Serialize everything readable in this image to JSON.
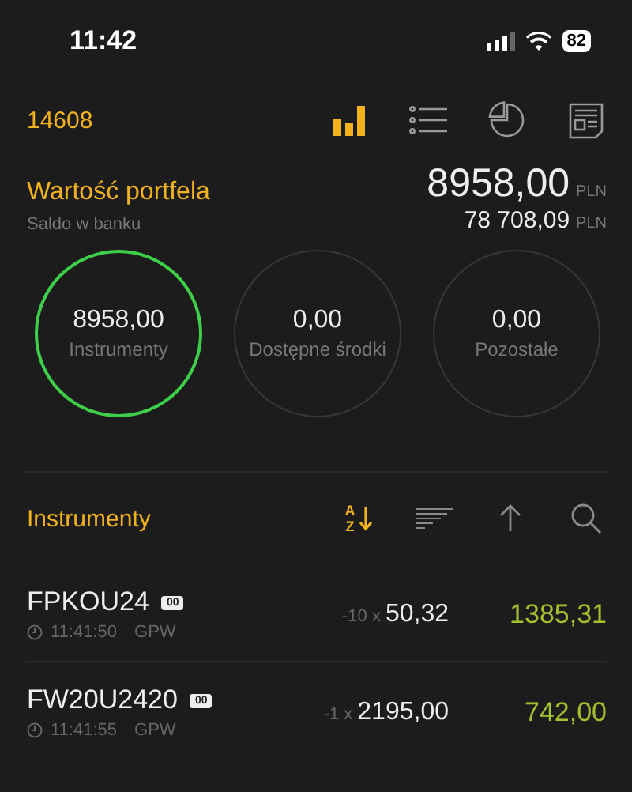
{
  "status_bar": {
    "time": "11:42",
    "battery": "82"
  },
  "header": {
    "account": "14608",
    "tabs": [
      {
        "kind": "bars",
        "selected": true
      },
      {
        "kind": "list",
        "selected": false
      },
      {
        "kind": "pie",
        "selected": false
      },
      {
        "kind": "news",
        "selected": false
      }
    ]
  },
  "portfolio": {
    "title": "Wartość portfela",
    "value": "8958,00",
    "currency": "PLN",
    "bank_label": "Saldo w banku",
    "bank_value": "78 708,09",
    "bank_currency": "PLN"
  },
  "circles": [
    {
      "value": "8958,00",
      "label": "Instrumenty",
      "selected": true
    },
    {
      "value": "0,00",
      "label": "Dostępne środki",
      "selected": false
    },
    {
      "value": "0,00",
      "label": "Pozostałe",
      "selected": false
    }
  ],
  "instruments": {
    "title": "Instrumenty",
    "tools": [
      {
        "kind": "az",
        "selected": true,
        "letters": [
          "A",
          "Z"
        ]
      },
      {
        "kind": "lines",
        "selected": false
      },
      {
        "kind": "up",
        "selected": false
      },
      {
        "kind": "search",
        "selected": false
      }
    ],
    "rows": [
      {
        "name": "FPKOU24",
        "badge": "00",
        "time": "11:41:50",
        "exchange": "GPW",
        "quantity": "-10 x",
        "price": "50,32",
        "value": "1385,31"
      },
      {
        "name": "FW20U2420",
        "badge": "00",
        "time": "11:41:55",
        "exchange": "GPW",
        "quantity": "-1 x",
        "price": "2195,00",
        "value": "742,00"
      }
    ]
  }
}
